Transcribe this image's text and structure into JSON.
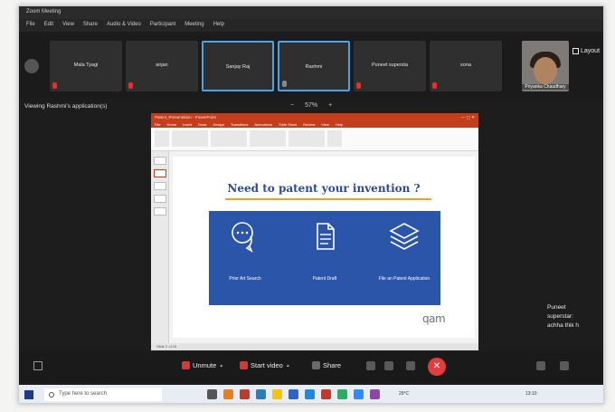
{
  "window": {
    "title": "Zoom Meeting",
    "menu": [
      "File",
      "Edit",
      "View",
      "Share",
      "Audio & Video",
      "Participant",
      "Meeting",
      "Help"
    ]
  },
  "participants": [
    {
      "name": "Mala Tyagi"
    },
    {
      "name": "anjan"
    },
    {
      "name": "Sanjay Raj"
    },
    {
      "name": "Rashmi"
    },
    {
      "name": "Puneet supersta"
    },
    {
      "name": "sona"
    }
  ],
  "self_view": {
    "name": "Priyanka Chaudhary"
  },
  "layout_button": "Layout",
  "share_banner": "Viewing Rashmi's application(s)",
  "zoom": {
    "minus": "−",
    "value": "57%",
    "plus": "+"
  },
  "ppt": {
    "title": "Patent_Presentation - PowerPoint",
    "tabs": [
      "File",
      "Home",
      "Insert",
      "Draw",
      "Design",
      "Transitions",
      "Animations",
      "Slide Show",
      "Review",
      "View",
      "Help"
    ],
    "status": "Slide 2 of 15"
  },
  "slide": {
    "title": "Need to patent your invention ?",
    "steps": [
      {
        "label": "Prior Art Search",
        "icon": "chat-bubbles-icon"
      },
      {
        "label": "Patent Draft",
        "icon": "document-icon"
      },
      {
        "label": "File an Patent Application",
        "icon": "layers-icon"
      }
    ],
    "logo": "qam"
  },
  "chat_snippet": [
    "Puneet",
    "superstar:",
    "achha thik h"
  ],
  "controls": {
    "unmute": "Unmute",
    "start_video": "Start video",
    "share": "Share",
    "end": "✕"
  },
  "taskbar": {
    "search_placeholder": "Type here to search",
    "time": "13:10",
    "weather": "29°C"
  },
  "colors": {
    "accent_border": "#4aa3e6",
    "slide_panel": "#2a55a8",
    "slide_title": "#2a4aa0",
    "ppt_brand": "#c43e1c",
    "end_call": "#e23d3d"
  }
}
